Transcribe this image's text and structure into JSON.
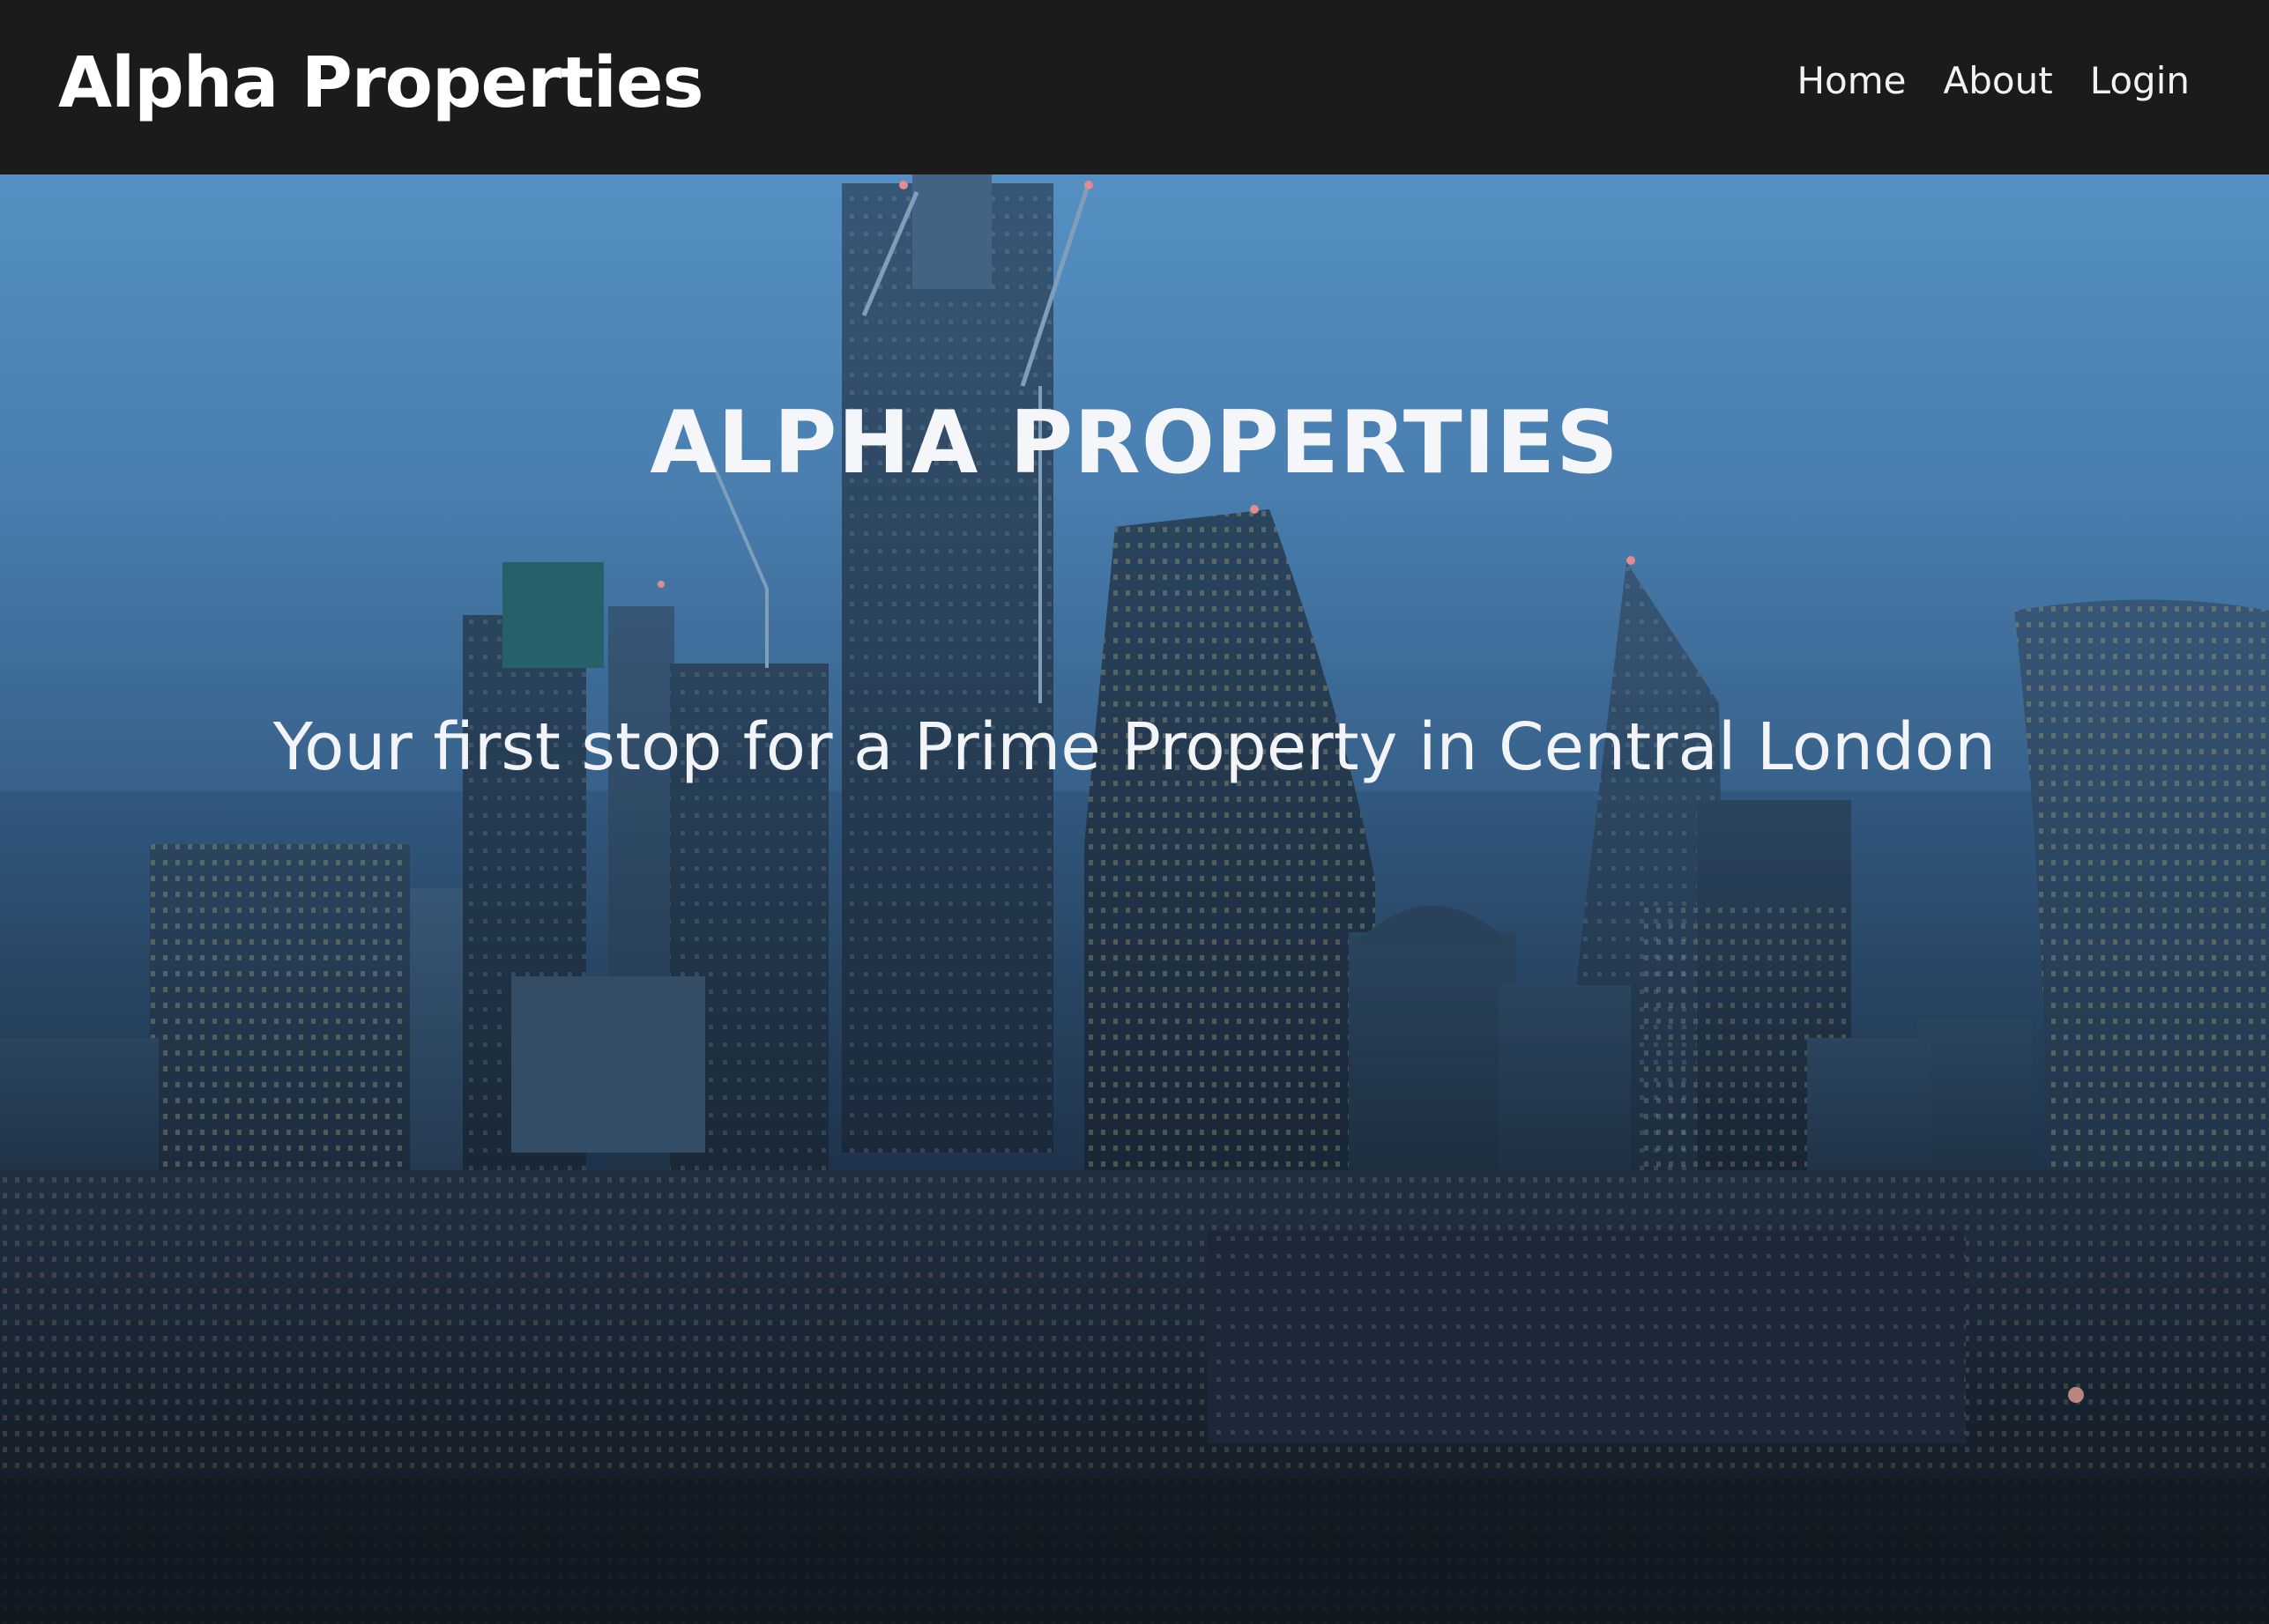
{
  "navbar": {
    "brand": "Alpha Properties",
    "links": [
      {
        "label": "Home"
      },
      {
        "label": "About"
      },
      {
        "label": "Login"
      }
    ]
  },
  "hero": {
    "title": "ALPHA PROPERTIES",
    "subtitle": "Your first stop for a Prime Property in Central London",
    "background_image": "city-skyline-dusk"
  },
  "colors": {
    "navbar_bg": "#1b1b1b",
    "text": "#ffffff",
    "sky_top": "#5e9fd8",
    "sky_bottom": "#121822"
  }
}
